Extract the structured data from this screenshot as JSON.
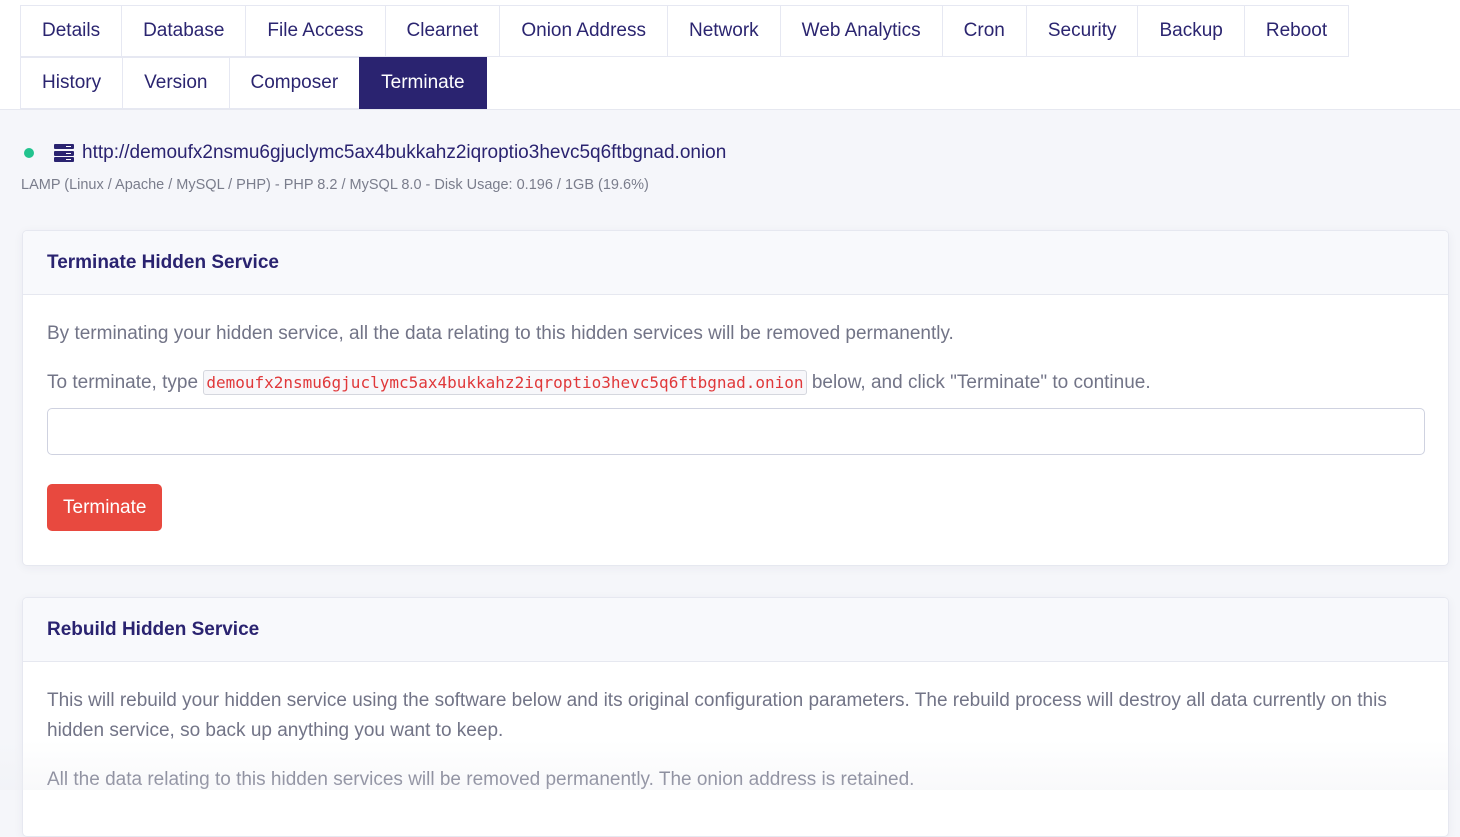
{
  "tabs": {
    "row1": [
      {
        "label": "Details"
      },
      {
        "label": "Database"
      },
      {
        "label": "File Access"
      },
      {
        "label": "Clearnet"
      },
      {
        "label": "Onion Address"
      },
      {
        "label": "Network"
      },
      {
        "label": "Web Analytics"
      },
      {
        "label": "Cron"
      },
      {
        "label": "Security"
      },
      {
        "label": "Backup"
      },
      {
        "label": "Reboot"
      }
    ],
    "row2": [
      {
        "label": "History"
      },
      {
        "label": "Version"
      },
      {
        "label": "Composer"
      },
      {
        "label": "Terminate",
        "active": true
      }
    ]
  },
  "service": {
    "status": "online",
    "status_color": "#22c38e",
    "icon": "server-icon",
    "url": "http://demoufx2nsmu6gjuclymc5ax4bukkahz2iqroptio3hevc5q6ftbgnad.onion",
    "meta": "LAMP (Linux / Apache / MySQL / PHP) - PHP 8.2 / MySQL 8.0 - Disk Usage: 0.196 / 1GB (19.6%)"
  },
  "terminate_card": {
    "title": "Terminate Hidden Service",
    "warning": "By terminating your hidden service, all the data relating to this hidden services will be removed permanently.",
    "instruction_prefix": "To terminate, type",
    "onion_code": "demoufx2nsmu6gjuclymc5ax4bukkahz2iqroptio3hevc5q6ftbgnad.onion",
    "instruction_suffix": "below, and click \"Terminate\" to continue.",
    "input_value": "",
    "input_placeholder": "",
    "button_label": "Terminate",
    "button_color": "#e8493f"
  },
  "rebuild_card": {
    "title": "Rebuild Hidden Service",
    "paragraph1": "This will rebuild your hidden service using the software below and its original configuration parameters. The rebuild process will destroy all data currently on this hidden service, so back up anything you want to keep.",
    "paragraph2": "All the data relating to this hidden services will be removed permanently. The onion address is retained."
  },
  "colors": {
    "brand": "#2a2370",
    "danger": "#e8493f",
    "code_text": "#e0383a"
  }
}
